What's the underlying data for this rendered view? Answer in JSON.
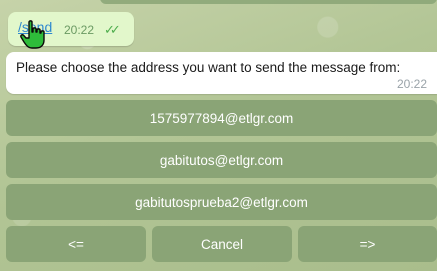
{
  "colors": {
    "wallpaper": "#b7c79a",
    "sent_bubble": "#e2f7cb",
    "link": "#2f89cf",
    "keyboard_button": "#8aa476",
    "keyboard_text": "#ffffff"
  },
  "sent_message": {
    "command": "/send",
    "time": "20:22",
    "status_icon": "double-check-icon"
  },
  "received_message": {
    "text": "Please choose the address you want to send the message from:",
    "time": "20:22"
  },
  "keyboard": {
    "addresses": [
      "1575977894@etlgr.com",
      "gabitutos@etlgr.com",
      "gabitutosprueba2@etlgr.com"
    ],
    "prev_label": "<=",
    "cancel_label": "Cancel",
    "next_label": "=>"
  },
  "cursor_icon": "hand-pointer-icon"
}
